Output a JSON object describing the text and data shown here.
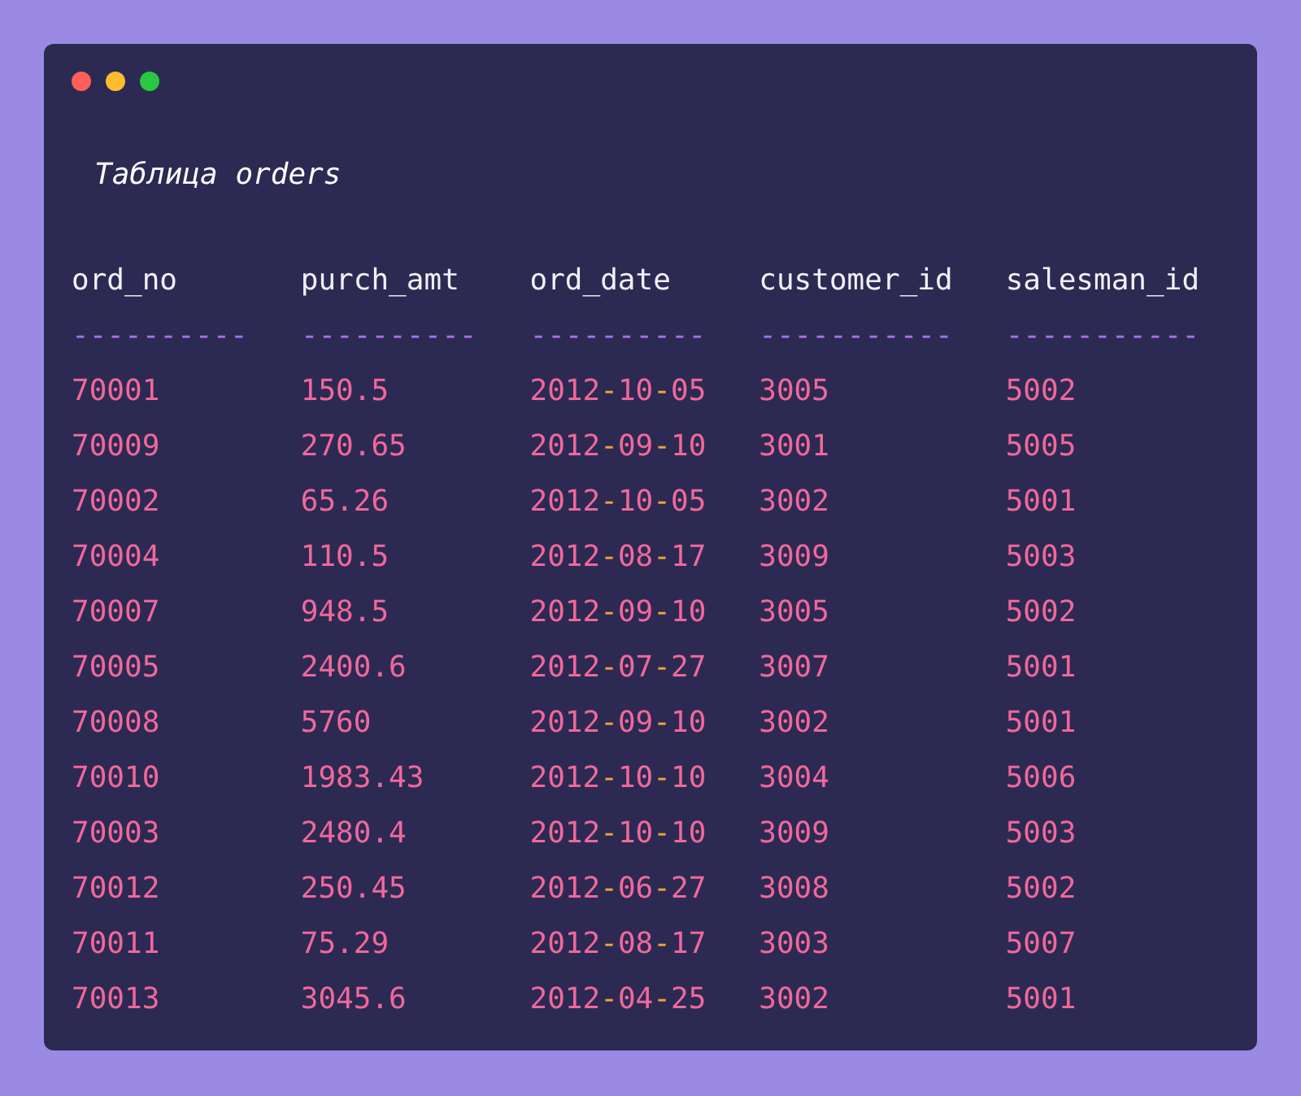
{
  "title": "Таблица orders",
  "columns": [
    "ord_no",
    "purch_amt",
    "ord_date",
    "customer_id",
    "salesman_id"
  ],
  "separators": [
    "----------",
    "----------",
    "----------",
    "-----------",
    "-----------"
  ],
  "rows": [
    [
      "70001",
      "150.5",
      "2012-10-05",
      "3005",
      "5002"
    ],
    [
      "70009",
      "270.65",
      "2012-09-10",
      "3001",
      "5005"
    ],
    [
      "70002",
      "65.26",
      "2012-10-05",
      "3002",
      "5001"
    ],
    [
      "70004",
      "110.5",
      "2012-08-17",
      "3009",
      "5003"
    ],
    [
      "70007",
      "948.5",
      "2012-09-10",
      "3005",
      "5002"
    ],
    [
      "70005",
      "2400.6",
      "2012-07-27",
      "3007",
      "5001"
    ],
    [
      "70008",
      "5760",
      "2012-09-10",
      "3002",
      "5001"
    ],
    [
      "70010",
      "1983.43",
      "2012-10-10",
      "3004",
      "5006"
    ],
    [
      "70003",
      "2480.4",
      "2012-10-10",
      "3009",
      "5003"
    ],
    [
      "70012",
      "250.45",
      "2012-06-27",
      "3008",
      "5002"
    ],
    [
      "70011",
      "75.29",
      "2012-08-17",
      "3003",
      "5007"
    ],
    [
      "70013",
      "3045.6",
      "2012-04-25",
      "3002",
      "5001"
    ]
  ]
}
